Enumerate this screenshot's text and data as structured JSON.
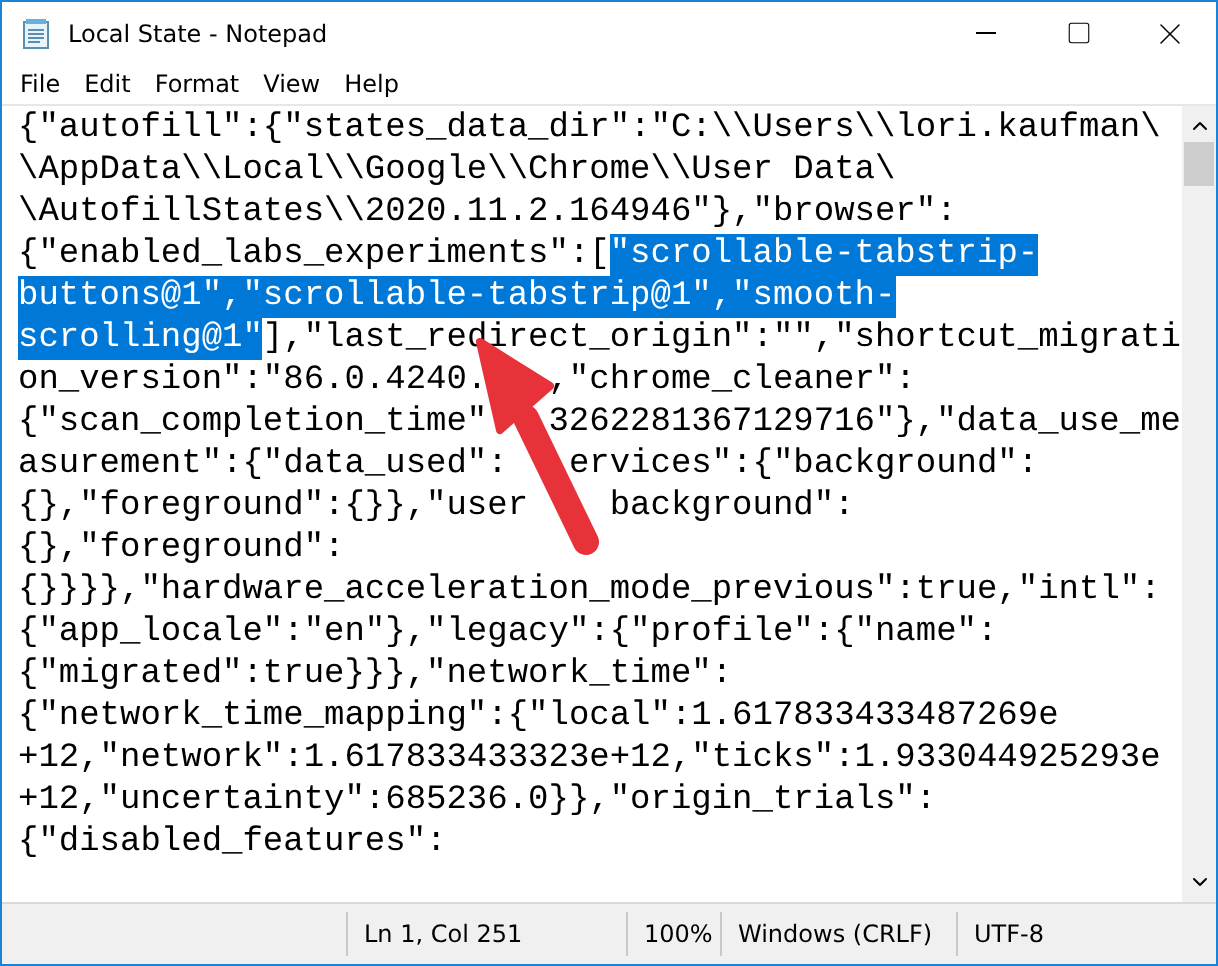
{
  "window": {
    "title": "Local State - Notepad"
  },
  "menu": [
    "File",
    "Edit",
    "Format",
    "View",
    "Help"
  ],
  "editor": {
    "lines": [
      [
        {
          "text": "{\"autofill\":{\"states_data_dir\":\"C:\\\\Users\\\\lori.kaufman\\",
          "selected": false
        }
      ],
      [
        {
          "text": "\\AppData\\\\Local\\\\Google\\\\Chrome\\\\User Data\\",
          "selected": false
        }
      ],
      [
        {
          "text": "\\AutofillStates\\\\2020.11.2.164946\"},\"browser\":",
          "selected": false
        }
      ],
      [
        {
          "text": "{\"enabled_labs_experiments\":[",
          "selected": false
        },
        {
          "text": "\"scrollable-tabstrip-",
          "selected": true
        }
      ],
      [
        {
          "text": "buttons@1\",\"scrollable-tabstrip@1\",\"smooth-",
          "selected": true
        }
      ],
      [
        {
          "text": "scrolling@1\"",
          "selected": true
        },
        {
          "text": "],\"last_redirect_origin\":\"\",\"shortcut_migrati",
          "selected": false
        }
      ],
      [
        {
          "text": "on_version\":\"86.0.4240.",
          "selected": false
        },
        {
          "text": ",\"chrome_cleaner\":",
          "selected": false,
          "after_cover": true
        }
      ],
      [
        {
          "text": "{\"scan_completion_time\"",
          "selected": false
        },
        {
          "text": "3262281367129716\"},\"data_use_me",
          "selected": false,
          "after_cover": true
        }
      ],
      [
        {
          "text": "asurement\":{\"data_used\":",
          "selected": false
        },
        {
          "text": "ervices\":{\"background\":",
          "selected": false,
          "after_cover": true
        }
      ],
      [
        {
          "text": "{},\"foreground\":{}},\"user",
          "selected": false
        },
        {
          "text": "background\":",
          "selected": false,
          "after_cover": true
        }
      ],
      [
        {
          "text": "{},\"foreground\":",
          "selected": false
        }
      ],
      [
        {
          "text": "{}}}},\"hardware_acceleration_mode_previous\":true,\"intl\":",
          "selected": false
        }
      ],
      [
        {
          "text": "{\"app_locale\":\"en\"},\"legacy\":{\"profile\":{\"name\":",
          "selected": false
        }
      ],
      [
        {
          "text": "{\"migrated\":true}}},\"network_time\":",
          "selected": false
        }
      ],
      [
        {
          "text": "{\"network_time_mapping\":{\"local\":1.617833433487269e",
          "selected": false
        }
      ],
      [
        {
          "text": "+12,\"network\":1.617833433323e+12,\"ticks\":1.933044925293e",
          "selected": false
        }
      ],
      [
        {
          "text": "+12,\"uncertainty\":685236.0}},\"origin_trials\":",
          "selected": false
        }
      ],
      [
        {
          "text": "{\"disabled_features\":",
          "selected": false
        }
      ]
    ]
  },
  "status_bar": [
    "Ln 1, Col 251",
    "100%",
    "Windows (CRLF)",
    "UTF-8"
  ]
}
